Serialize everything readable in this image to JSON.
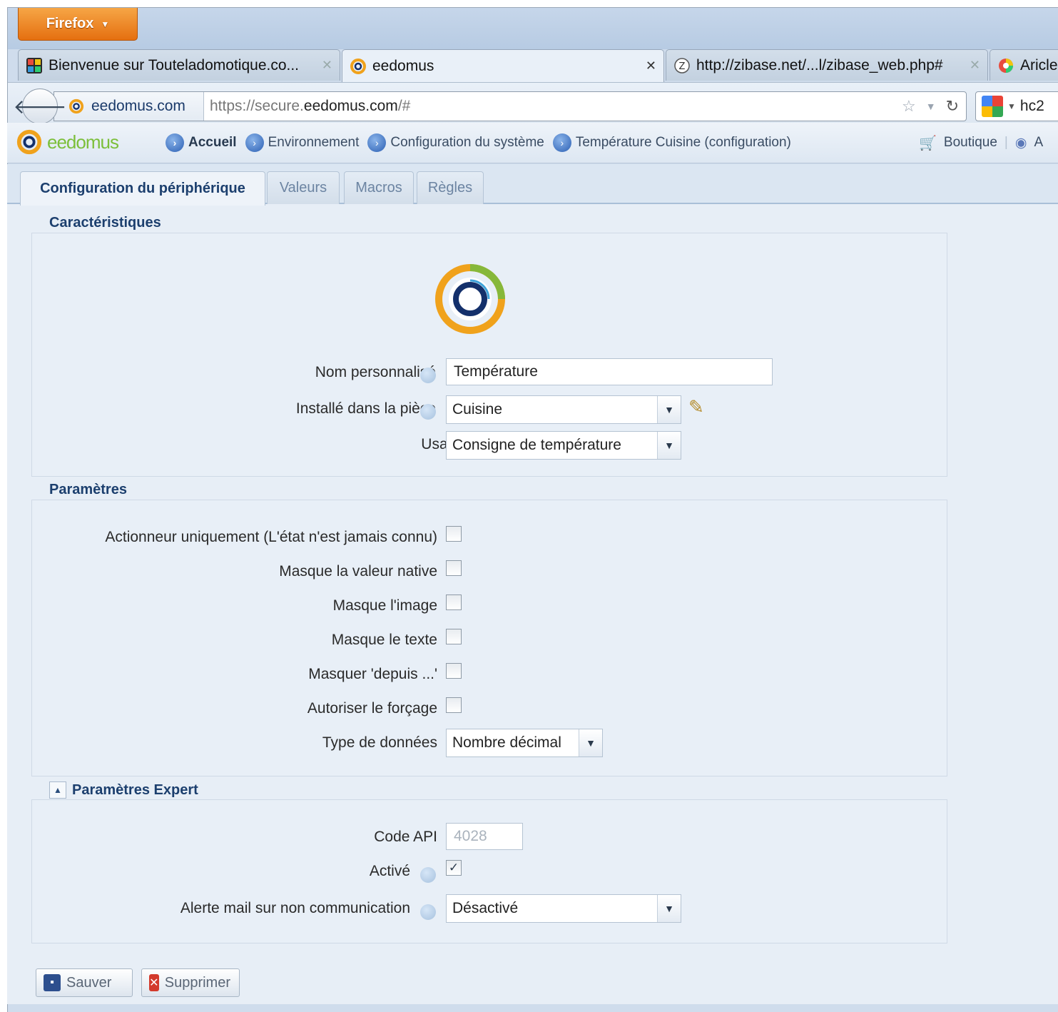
{
  "browser": {
    "menu_button": "Firefox",
    "tabs": [
      {
        "title": "Bienvenue sur Touteladomotique.co...",
        "active": false
      },
      {
        "title": "eedomus",
        "active": true
      },
      {
        "title": "http://zibase.net/...l/zibase_web.php#",
        "active": false
      },
      {
        "title": "Aricle",
        "active": false
      }
    ],
    "identity": "eedomus.com",
    "url_prefix": "https://secure.",
    "url_domain": "eedomus.com",
    "url_suffix": "/#",
    "search_text": "hc2"
  },
  "app": {
    "logo_text": "eedomus",
    "breadcrumb": [
      {
        "label": "Accueil"
      },
      {
        "label": "Environnement"
      },
      {
        "label": "Configuration du système"
      },
      {
        "label": "Température Cuisine (configuration)"
      }
    ],
    "shop": "Boutique",
    "next_item_partial": "A"
  },
  "subtabs": [
    {
      "label": "Configuration du périphérique",
      "active": true
    },
    {
      "label": "Valeurs",
      "active": false
    },
    {
      "label": "Macros",
      "active": false
    },
    {
      "label": "Règles",
      "active": false
    }
  ],
  "characteristics": {
    "legend": "Caractéristiques",
    "name_label": "Nom personnalisé",
    "name_value": "Température",
    "room_label": "Installé dans la pièce",
    "room_value": "Cuisine",
    "usage_label": "Usage",
    "usage_value": "Consigne de température"
  },
  "parameters": {
    "legend": "Paramètres",
    "checkboxes": [
      {
        "label": "Actionneur uniquement (L'état n'est jamais connu)",
        "checked": false
      },
      {
        "label": "Masque la valeur native",
        "checked": false
      },
      {
        "label": "Masque l'image",
        "checked": false
      },
      {
        "label": "Masque le texte",
        "checked": false
      },
      {
        "label": "Masquer 'depuis ...'",
        "checked": false
      },
      {
        "label": "Autoriser le forçage",
        "checked": false
      }
    ],
    "data_type_label": "Type de données",
    "data_type_value": "Nombre décimal"
  },
  "expert": {
    "legend": "Paramètres Expert",
    "api_label": "Code API",
    "api_value": "4028",
    "active_label": "Activé",
    "active_checked": true,
    "alert_label": "Alerte mail sur non communication",
    "alert_value": "Désactivé"
  },
  "actions": {
    "save": "Sauver",
    "delete": "Supprimer"
  },
  "colors": {
    "accent_blue": "#1c3f6e",
    "firefox_orange": "#e56f10",
    "logo_green": "#7cbf3a",
    "delete_red": "#d33a2c"
  }
}
